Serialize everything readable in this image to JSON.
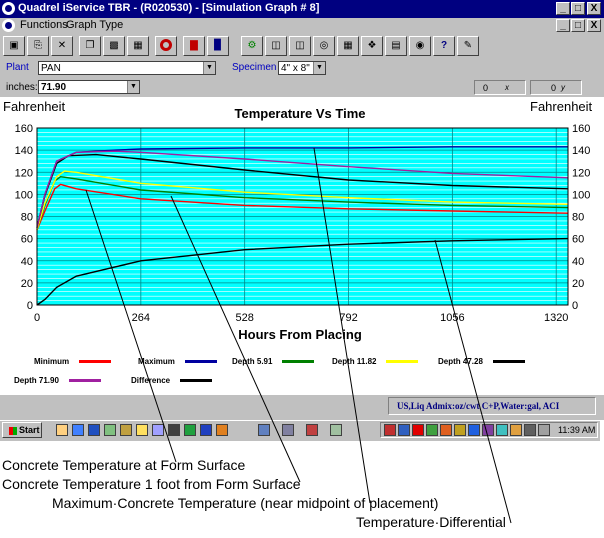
{
  "window": {
    "title": "Quadrel iService  TBR  - (R020530) - [Simulation Graph # 8]",
    "controls": [
      "_",
      "□",
      "X"
    ]
  },
  "menu": {
    "items": [
      "Functions",
      "Graph Type"
    ]
  },
  "selectors": {
    "plant_label": "Plant",
    "plant_value": "PAN",
    "specimen_label": "Specimen",
    "specimen_value": "4\" x 8\"",
    "inches_label": "inches:",
    "inches_value": "71.90",
    "x_readout": "0",
    "x_readout_label": "x axis",
    "y_readout": "0",
    "y_readout_label": "y axis"
  },
  "chart_data": {
    "type": "line",
    "title": "Temperature Vs Time",
    "xlabel": "Hours From Placing",
    "ylabel": "Fahrenheit",
    "ylabel_right": "Fahrenheit",
    "xlim": [
      0,
      1350
    ],
    "ylim": [
      0,
      160
    ],
    "xticks": [
      0,
      264,
      528,
      792,
      1056,
      1320
    ],
    "yticks": [
      0,
      20,
      40,
      60,
      80,
      100,
      120,
      140,
      160
    ],
    "grid": true,
    "series": [
      {
        "name": "Minimum",
        "color": "#ff0000",
        "points": [
          [
            0,
            68
          ],
          [
            20,
            85
          ],
          [
            45,
            105
          ],
          [
            60,
            109
          ],
          [
            100,
            105
          ],
          [
            264,
            96
          ],
          [
            528,
            90
          ],
          [
            792,
            87
          ],
          [
            1056,
            85
          ],
          [
            1350,
            83
          ]
        ]
      },
      {
        "name": "Maximum",
        "color": "#0000a0",
        "points": [
          [
            0,
            70
          ],
          [
            20,
            100
          ],
          [
            50,
            130
          ],
          [
            100,
            138
          ],
          [
            200,
            140
          ],
          [
            264,
            141
          ],
          [
            528,
            142
          ],
          [
            792,
            142
          ],
          [
            1056,
            143
          ],
          [
            1350,
            143
          ]
        ]
      },
      {
        "name": "Depth  5.91",
        "color": "#008000",
        "points": [
          [
            0,
            68
          ],
          [
            20,
            90
          ],
          [
            45,
            112
          ],
          [
            60,
            116
          ],
          [
            100,
            114
          ],
          [
            264,
            104
          ],
          [
            528,
            97
          ],
          [
            792,
            93
          ],
          [
            1056,
            90
          ],
          [
            1350,
            88
          ]
        ]
      },
      {
        "name": "Depth  11.82",
        "color": "#ffff00",
        "points": [
          [
            0,
            68
          ],
          [
            20,
            92
          ],
          [
            50,
            116
          ],
          [
            70,
            121
          ],
          [
            100,
            120
          ],
          [
            264,
            110
          ],
          [
            528,
            102
          ],
          [
            792,
            97
          ],
          [
            1056,
            93
          ],
          [
            1350,
            91
          ]
        ]
      },
      {
        "name": "Depth  47.28",
        "color": "#000000",
        "points": [
          [
            0,
            70
          ],
          [
            20,
            99
          ],
          [
            50,
            128
          ],
          [
            80,
            135
          ],
          [
            150,
            136
          ],
          [
            264,
            132
          ],
          [
            528,
            122
          ],
          [
            792,
            113
          ],
          [
            1056,
            108
          ],
          [
            1350,
            105
          ]
        ]
      },
      {
        "name": "Depth  71.90",
        "color": "#a020a0",
        "points": [
          [
            0,
            70
          ],
          [
            20,
            100
          ],
          [
            50,
            130
          ],
          [
            100,
            138
          ],
          [
            200,
            139
          ],
          [
            264,
            138
          ],
          [
            528,
            132
          ],
          [
            792,
            125
          ],
          [
            1056,
            119
          ],
          [
            1350,
            115
          ]
        ]
      },
      {
        "name": "Difference",
        "color": "#000000",
        "points": [
          [
            0,
            0
          ],
          [
            20,
            5
          ],
          [
            50,
            16
          ],
          [
            100,
            26
          ],
          [
            264,
            40
          ],
          [
            528,
            50
          ],
          [
            792,
            55
          ],
          [
            1056,
            58
          ],
          [
            1200,
            59
          ],
          [
            1350,
            60
          ]
        ]
      }
    ]
  },
  "legend": [
    {
      "name": "Minimum",
      "color": "#ff0000"
    },
    {
      "name": "Maximum",
      "color": "#0000a0"
    },
    {
      "name": "Depth  5.91",
      "color": "#008000"
    },
    {
      "name": "Depth  11.82",
      "color": "#ffff00"
    },
    {
      "name": "Depth  47.28",
      "color": "#000000"
    },
    {
      "name": "Depth  71.90",
      "color": "#a020a0"
    },
    {
      "name": "Difference",
      "color": "#000000"
    }
  ],
  "status": {
    "units": "US,Liq Admix:oz/cwt C+P,Water:gal, ACI"
  },
  "taskbar": {
    "start_label": "Start",
    "clock": "11:39 AM"
  },
  "annotations": [
    "Concrete Temperature at Form Surface",
    "Concrete Temperature 1 foot from Form Surface",
    "Maximum·Concrete Temperature (near midpoint of placement)",
    "Temperature·Differential"
  ]
}
